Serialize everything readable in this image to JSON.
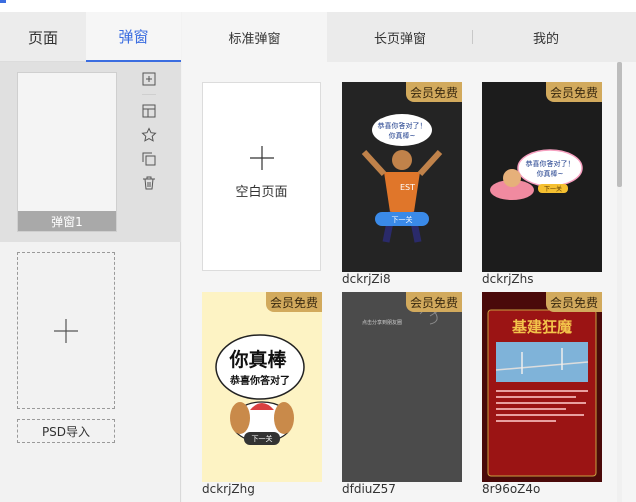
{
  "left_tabs": {
    "page": "页面",
    "popup": "弹窗"
  },
  "popup_item": {
    "label": "弹窗1"
  },
  "tools": {
    "add": "plus-square-icon",
    "layout": "layout-icon",
    "favorite": "star-icon",
    "copy": "copy-icon",
    "delete": "trash-icon"
  },
  "psd_import_label": "PSD导入",
  "right_tabs": {
    "standard": "标准弹窗",
    "long": "长页弹窗",
    "mine": "我的"
  },
  "blank_page_label": "空白页面",
  "badge_text": "会员免费",
  "templates": [
    {
      "name": "dckrjZi8",
      "bubble": "恭喜你答对了！你真棒~",
      "button": "下一关"
    },
    {
      "name": "dckrjZhs",
      "bubble": "恭喜你答对了！你真棒~",
      "button": "下一关"
    },
    {
      "name": "dckrjZhg",
      "headline": "你真棒",
      "sub": "恭喜你答对了",
      "button": "下一关"
    },
    {
      "name": "dfdiuZ57",
      "caption": "点击分享到朋友圈"
    },
    {
      "name": "8r96oZ4o",
      "title": "基建狂魔"
    }
  ],
  "colors": {
    "accent": "#3b6de0",
    "badge": "#d2aa5d"
  }
}
